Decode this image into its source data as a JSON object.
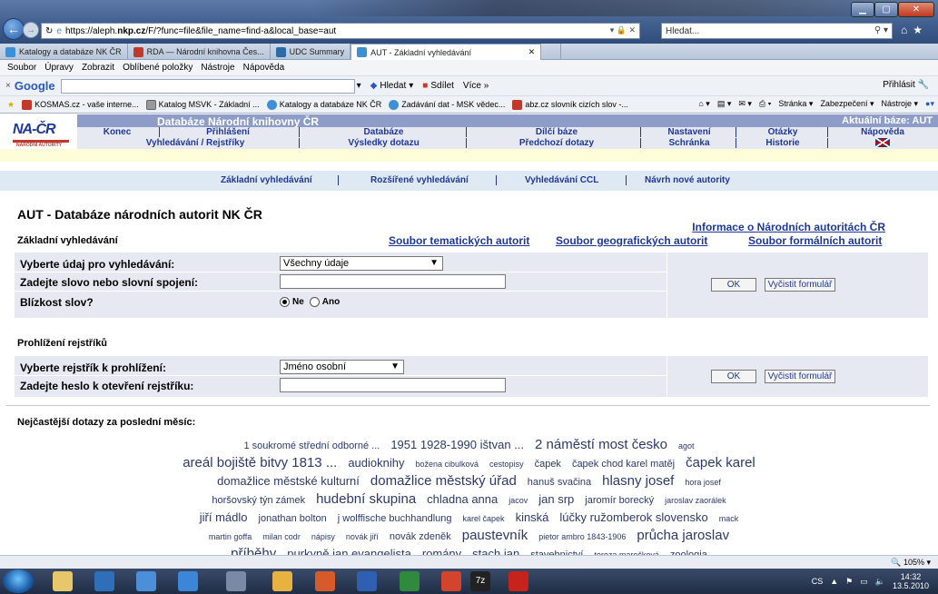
{
  "browser": {
    "url_prefix": "https://aleph.",
    "url_host": "nkp.cz",
    "url_rest": "/F/?func=file&file_name=find-a&local_base=aut",
    "search_placeholder": "Hledat...",
    "tabs": [
      {
        "label": "Katalogy a databáze NK ČR",
        "color": "#3e8fd6"
      },
      {
        "label": "RDA — Národní knihovna Čes...",
        "color": "#c0392b"
      },
      {
        "label": "UDC Summary",
        "color": "#2d6aa8"
      },
      {
        "label": "AUT - Základní vyhledávání",
        "color": "#3e8fd6"
      }
    ],
    "menu": [
      "Soubor",
      "Úpravy",
      "Zobrazit",
      "Oblíbené položky",
      "Nástroje",
      "Nápověda"
    ],
    "google_toolbar": {
      "logo": "Google",
      "search_label": "Hledat",
      "share_label": "Sdílet",
      "more_label": "Více »",
      "signin": "Přihlásit"
    },
    "favorites": [
      "KOSMAS.cz - vaše interne...",
      "Katalog MSVK - Základní ...",
      "Katalogy a databáze NK ČR",
      "Zadávání dat - MSK vědec...",
      "abz.cz slovník cizích slov -..."
    ],
    "command_bar": [
      "Stránka ▾",
      "Zabezpečení ▾",
      "Nástroje ▾"
    ],
    "zoom": "105%"
  },
  "header": {
    "logo": "NA-ČR",
    "logo_sub": "NÁRODNÍ AUTORITY",
    "title": "Databáze Národní knihovny ČR",
    "current_base": "Aktuální báze:  AUT",
    "row1": [
      "Konec",
      "Přihlášení",
      "Databáze",
      "Dílčí báze",
      "Nastavení",
      "Otázky",
      "Nápověda"
    ],
    "row2": [
      "Vyhledávání / Rejstříky",
      "Výsledky dotazu",
      "Předchozí dotazy",
      "Schránka",
      "Historie"
    ]
  },
  "subnav": [
    "Základní vyhledávání",
    "Rozšířené vyhledávání",
    "Vyhledávání CCL",
    "Návrh nové autority"
  ],
  "main": {
    "heading": "AUT - Databáze národních autorit NK ČR",
    "info_link": "Informace o Národních autoritách ČR",
    "basic": {
      "title": "Základní vyhledávání",
      "links": [
        "Soubor tematických autorit",
        "Soubor geografických autorit",
        "Soubor formálních autorit"
      ],
      "field_label": "Vyberte údaj pro vyhledávání:",
      "field_value": "Všechny údaje",
      "word_label": "Zadejte slovo nebo slovní spojení:",
      "proximity_label": "Blízkost slov?",
      "radio_no": "Ne",
      "radio_yes": "Ano",
      "ok": "OK",
      "clear": "Vyčistit formulář"
    },
    "browse": {
      "title": "Prohlížení rejstříků",
      "index_label": "Vyberte rejstřík k prohlížení:",
      "index_value": "Jméno osobní",
      "heading_label": "Zadejte heslo k otevření rejstříku:",
      "ok": "OK",
      "clear": "Vyčistit formulář"
    },
    "frequent_title": "Nejčastější dotazy za poslední měsíc:",
    "cloud": [
      [
        [
          "1 soukromé střední odborné ...",
          2
        ],
        [
          "1951 1928-1990 ištvan ...",
          3
        ],
        [
          "2 náměstí most česko",
          4
        ],
        [
          "agot",
          1
        ]
      ],
      [
        [
          "areál bojiště bitvy 1813 ...",
          4
        ],
        [
          "audioknihy",
          3
        ],
        [
          "božena cibulková",
          1
        ],
        [
          "cestopisy",
          1
        ],
        [
          "čapek",
          2
        ],
        [
          "čapek chod karel matěj",
          2
        ],
        [
          "čapek karel",
          4
        ]
      ],
      [
        [
          "domažlice městské kulturní",
          3
        ],
        [
          "domažlice městský úřad",
          4
        ],
        [
          "hanuš svačina",
          2
        ],
        [
          "hlasny josef",
          4
        ],
        [
          "hora josef",
          1
        ]
      ],
      [
        [
          "horšovský týn zámek",
          2
        ],
        [
          "hudební skupina",
          4
        ],
        [
          "chladna anna",
          3
        ],
        [
          "jacov",
          1
        ],
        [
          "jan srp",
          3
        ],
        [
          "jaromír borecký",
          2
        ],
        [
          "jaroslav zaorálek",
          1
        ]
      ],
      [
        [
          "jiří mádlo",
          3
        ],
        [
          "jonathan bolton",
          2
        ],
        [
          "j wolffische buchhandlung",
          2
        ],
        [
          "karel čapek",
          1
        ],
        [
          "kinská",
          3
        ],
        [
          "lúčky ružomberok slovensko",
          3
        ],
        [
          "mack",
          1
        ]
      ],
      [
        [
          "martin goffa",
          1
        ],
        [
          "milan codr",
          1
        ],
        [
          "nápisy",
          1
        ],
        [
          "novák jiří",
          1
        ],
        [
          "novák zdeněk",
          2
        ],
        [
          "paustevník",
          4
        ],
        [
          "pietor ambro 1843-1906",
          1
        ],
        [
          "průcha jaroslav",
          4
        ]
      ],
      [
        [
          "příběhy",
          4
        ],
        [
          "purkyně jan evangelista",
          3
        ],
        [
          "romány",
          3
        ],
        [
          "stach jan",
          3
        ],
        [
          "stavebnictví",
          2
        ],
        [
          "tereza marečková",
          1
        ],
        [
          "zoologia",
          2
        ]
      ]
    ]
  },
  "taskbar": {
    "lang": "CS",
    "time": "14:32",
    "date": "13.5.2010"
  }
}
